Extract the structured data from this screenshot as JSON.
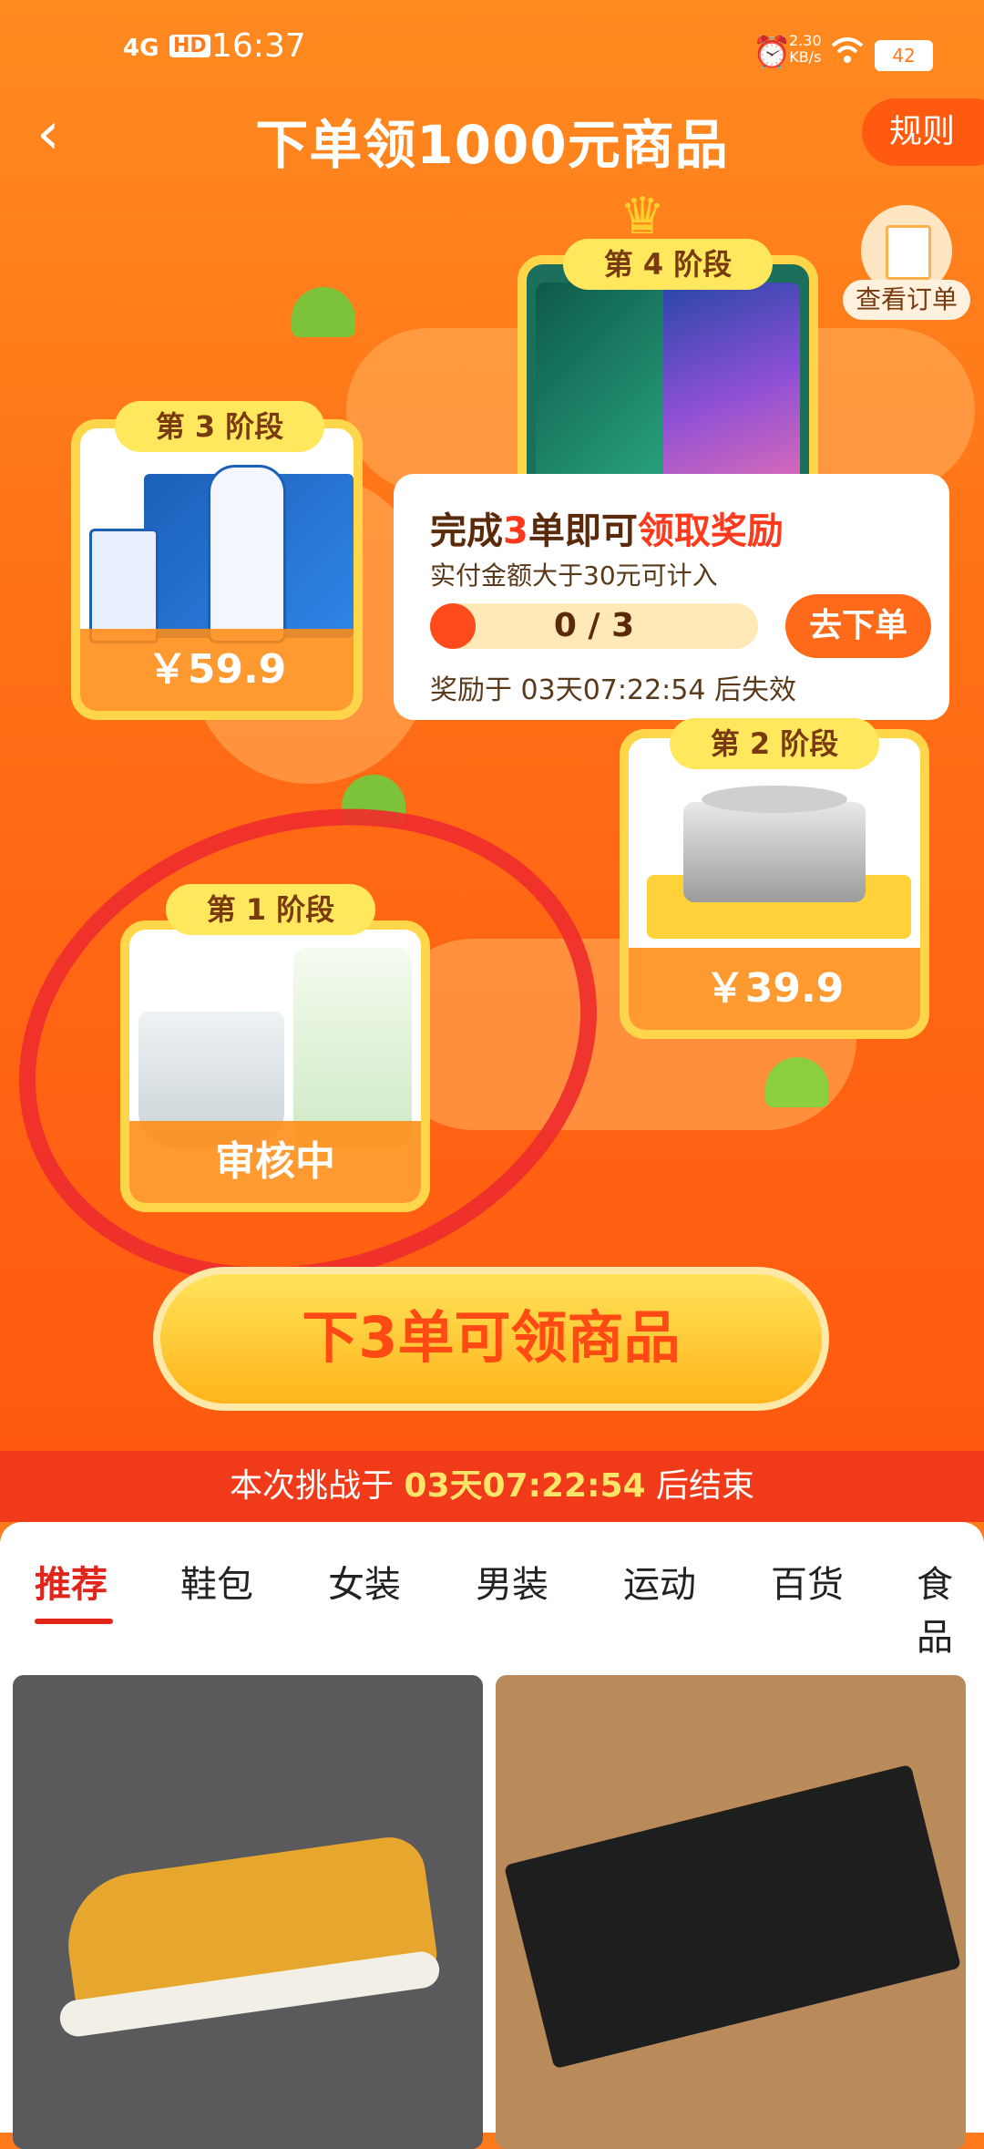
{
  "status_bar": {
    "network": "4G",
    "hd": "HD",
    "time": "16:37",
    "speed": "2.30\nKB/s",
    "battery": "42"
  },
  "header": {
    "title": "下单领1000元商品",
    "rules": "规则",
    "orders": "查看订单"
  },
  "stages": [
    {
      "tag": "第 1 阶段",
      "status": "审核中"
    },
    {
      "tag": "第 2 阶段",
      "price": "￥39.9"
    },
    {
      "tag": "第 3 阶段",
      "price": "￥59.9"
    },
    {
      "tag": "第 4 阶段"
    }
  ],
  "task": {
    "title_prefix": "完成",
    "title_count": "3",
    "title_mid": "单即可",
    "title_reward": "领取奖励",
    "subtitle": "实付金额大于30元可计入",
    "progress_text": "0 / 3",
    "progress_value": 0,
    "button": "去下单",
    "expire_text": "奖励于 03天07:22:54 后失效"
  },
  "main_button": "下3单可领商品",
  "challenge": {
    "prefix": "本次挑战于 ",
    "time": "03天07:22:54",
    "suffix": " 后结束"
  },
  "tabs": [
    "推荐",
    "鞋包",
    "女装",
    "男装",
    "运动",
    "百货",
    "食品"
  ],
  "colors": {
    "primary": "#ff7a1c",
    "accent_red": "#e1251b",
    "gold": "#ffd54a"
  }
}
